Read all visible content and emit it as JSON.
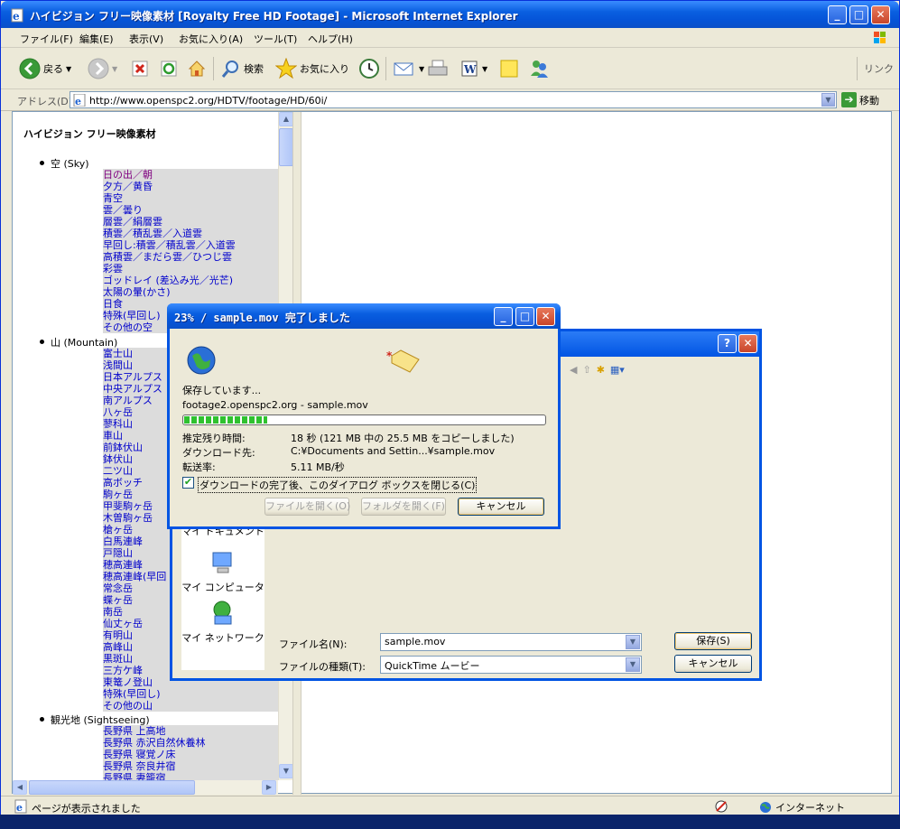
{
  "window": {
    "title": "ハイビジョン フリー映像素材 [Royalty Free HD Footage] - Microsoft Internet Explorer",
    "minimize": "_",
    "maximize": "□",
    "close": "✕"
  },
  "menu": [
    "ファイル(F)",
    "編集(E)",
    "表示(V)",
    "お気に入り(A)",
    "ツール(T)",
    "ヘルプ(H)"
  ],
  "toolbar": {
    "back": "戻る",
    "search": "検索",
    "favorites": "お気に入り",
    "links": "リンク"
  },
  "address": {
    "label": "アドレス(D)",
    "url": "http://www.openspc2.org/HDTV/footage/HD/60i/",
    "go": "移動"
  },
  "page": {
    "heading": "ハイビジョン フリー映像素材",
    "categories": [
      {
        "name": "空 (Sky)",
        "links": [
          "日の出／朝",
          "夕方／黄昏",
          "青空",
          "雲／曇り",
          "層雲／絹層雲",
          "積雲／積乱雲／入道雲",
          "早回し:積雲／積乱雲／入道雲",
          "高積雲／まだら雲／ひつじ雲",
          "彩雲",
          "ゴッドレイ (差込み光／光芒)",
          "太陽の暈(かさ)",
          "日食",
          "特殊(早回し)",
          "その他の空"
        ]
      },
      {
        "name": "山 (Mountain)",
        "links": [
          "富士山",
          "浅間山",
          "日本アルプス",
          "中央アルプス",
          "南アルプス",
          "八ヶ岳",
          "蓼科山",
          "車山",
          "前鉢伏山",
          "鉢伏山",
          "二ツ山",
          "高ボッチ",
          "駒ヶ岳",
          "甲斐駒ヶ岳",
          "木曽駒ヶ岳",
          "槍ヶ岳",
          "白馬連峰",
          "戸隠山",
          "穂高連峰",
          "穂高連峰(早回",
          "常念岳",
          "蝶ヶ岳",
          "南岳",
          "仙丈ヶ岳",
          "有明山",
          "高峰山",
          "黒斑山",
          "三方ケ峰",
          "東篭ノ登山",
          "特殊(早回し)",
          "その他の山"
        ]
      },
      {
        "name": "観光地 (Sightseeing)",
        "links": [
          "長野県 上高地",
          "長野県 赤沢自然休養林",
          "長野県 寝覚ノ床",
          "長野県 奈良井宿",
          "長野県 妻籠宿"
        ]
      }
    ]
  },
  "status": {
    "text": "ページが表示されました",
    "zone": "インターネット"
  },
  "save_dialog": {
    "help": "?",
    "close": "✕",
    "places": [
      "マイ ドキュメント",
      "マイ コンピュータ",
      "マイ ネットワーク"
    ],
    "filename_label": "ファイル名(N):",
    "filename_value": "sample.mov",
    "filetype_label": "ファイルの種類(T):",
    "filetype_value": "QuickTime ムービー",
    "save_button": "保存(S)",
    "cancel_button": "キャンセル"
  },
  "download_dialog": {
    "title": "23% / sample.mov 完了しました",
    "saving": "保存しています...",
    "source": "footage2.openspc2.org - sample.mov",
    "progress_percent": 23,
    "remaining_label": "推定残り時間:",
    "remaining_value": "18 秒 (121 MB 中の 25.5 MB をコピーしました)",
    "destination_label": "ダウンロード先:",
    "destination_value": "C:¥Documents and Settin...¥sample.mov",
    "rate_label": "転送率:",
    "rate_value": "5.11 MB/秒",
    "close_checkbox": "ダウンロードの完了後、このダイアログ ボックスを閉じる(C)",
    "open_file": "ファイルを開く(O)",
    "open_folder": "フォルダを開く(F)",
    "cancel": "キャンセル"
  },
  "colors": {
    "titlebar": "#0554d8",
    "link": "#0000cc",
    "visited": "#800080",
    "progress": "#2fc12f"
  }
}
